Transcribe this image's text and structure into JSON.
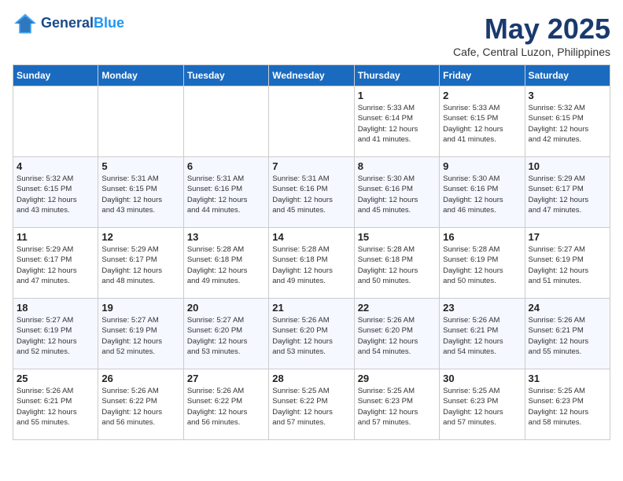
{
  "header": {
    "logo_line1": "General",
    "logo_line2": "Blue",
    "month": "May 2025",
    "location": "Cafe, Central Luzon, Philippines"
  },
  "weekdays": [
    "Sunday",
    "Monday",
    "Tuesday",
    "Wednesday",
    "Thursday",
    "Friday",
    "Saturday"
  ],
  "weeks": [
    [
      {
        "day": "",
        "info": ""
      },
      {
        "day": "",
        "info": ""
      },
      {
        "day": "",
        "info": ""
      },
      {
        "day": "",
        "info": ""
      },
      {
        "day": "1",
        "info": "Sunrise: 5:33 AM\nSunset: 6:14 PM\nDaylight: 12 hours\nand 41 minutes."
      },
      {
        "day": "2",
        "info": "Sunrise: 5:33 AM\nSunset: 6:15 PM\nDaylight: 12 hours\nand 41 minutes."
      },
      {
        "day": "3",
        "info": "Sunrise: 5:32 AM\nSunset: 6:15 PM\nDaylight: 12 hours\nand 42 minutes."
      }
    ],
    [
      {
        "day": "4",
        "info": "Sunrise: 5:32 AM\nSunset: 6:15 PM\nDaylight: 12 hours\nand 43 minutes."
      },
      {
        "day": "5",
        "info": "Sunrise: 5:31 AM\nSunset: 6:15 PM\nDaylight: 12 hours\nand 43 minutes."
      },
      {
        "day": "6",
        "info": "Sunrise: 5:31 AM\nSunset: 6:16 PM\nDaylight: 12 hours\nand 44 minutes."
      },
      {
        "day": "7",
        "info": "Sunrise: 5:31 AM\nSunset: 6:16 PM\nDaylight: 12 hours\nand 45 minutes."
      },
      {
        "day": "8",
        "info": "Sunrise: 5:30 AM\nSunset: 6:16 PM\nDaylight: 12 hours\nand 45 minutes."
      },
      {
        "day": "9",
        "info": "Sunrise: 5:30 AM\nSunset: 6:16 PM\nDaylight: 12 hours\nand 46 minutes."
      },
      {
        "day": "10",
        "info": "Sunrise: 5:29 AM\nSunset: 6:17 PM\nDaylight: 12 hours\nand 47 minutes."
      }
    ],
    [
      {
        "day": "11",
        "info": "Sunrise: 5:29 AM\nSunset: 6:17 PM\nDaylight: 12 hours\nand 47 minutes."
      },
      {
        "day": "12",
        "info": "Sunrise: 5:29 AM\nSunset: 6:17 PM\nDaylight: 12 hours\nand 48 minutes."
      },
      {
        "day": "13",
        "info": "Sunrise: 5:28 AM\nSunset: 6:18 PM\nDaylight: 12 hours\nand 49 minutes."
      },
      {
        "day": "14",
        "info": "Sunrise: 5:28 AM\nSunset: 6:18 PM\nDaylight: 12 hours\nand 49 minutes."
      },
      {
        "day": "15",
        "info": "Sunrise: 5:28 AM\nSunset: 6:18 PM\nDaylight: 12 hours\nand 50 minutes."
      },
      {
        "day": "16",
        "info": "Sunrise: 5:28 AM\nSunset: 6:19 PM\nDaylight: 12 hours\nand 50 minutes."
      },
      {
        "day": "17",
        "info": "Sunrise: 5:27 AM\nSunset: 6:19 PM\nDaylight: 12 hours\nand 51 minutes."
      }
    ],
    [
      {
        "day": "18",
        "info": "Sunrise: 5:27 AM\nSunset: 6:19 PM\nDaylight: 12 hours\nand 52 minutes."
      },
      {
        "day": "19",
        "info": "Sunrise: 5:27 AM\nSunset: 6:19 PM\nDaylight: 12 hours\nand 52 minutes."
      },
      {
        "day": "20",
        "info": "Sunrise: 5:27 AM\nSunset: 6:20 PM\nDaylight: 12 hours\nand 53 minutes."
      },
      {
        "day": "21",
        "info": "Sunrise: 5:26 AM\nSunset: 6:20 PM\nDaylight: 12 hours\nand 53 minutes."
      },
      {
        "day": "22",
        "info": "Sunrise: 5:26 AM\nSunset: 6:20 PM\nDaylight: 12 hours\nand 54 minutes."
      },
      {
        "day": "23",
        "info": "Sunrise: 5:26 AM\nSunset: 6:21 PM\nDaylight: 12 hours\nand 54 minutes."
      },
      {
        "day": "24",
        "info": "Sunrise: 5:26 AM\nSunset: 6:21 PM\nDaylight: 12 hours\nand 55 minutes."
      }
    ],
    [
      {
        "day": "25",
        "info": "Sunrise: 5:26 AM\nSunset: 6:21 PM\nDaylight: 12 hours\nand 55 minutes."
      },
      {
        "day": "26",
        "info": "Sunrise: 5:26 AM\nSunset: 6:22 PM\nDaylight: 12 hours\nand 56 minutes."
      },
      {
        "day": "27",
        "info": "Sunrise: 5:26 AM\nSunset: 6:22 PM\nDaylight: 12 hours\nand 56 minutes."
      },
      {
        "day": "28",
        "info": "Sunrise: 5:25 AM\nSunset: 6:22 PM\nDaylight: 12 hours\nand 57 minutes."
      },
      {
        "day": "29",
        "info": "Sunrise: 5:25 AM\nSunset: 6:23 PM\nDaylight: 12 hours\nand 57 minutes."
      },
      {
        "day": "30",
        "info": "Sunrise: 5:25 AM\nSunset: 6:23 PM\nDaylight: 12 hours\nand 57 minutes."
      },
      {
        "day": "31",
        "info": "Sunrise: 5:25 AM\nSunset: 6:23 PM\nDaylight: 12 hours\nand 58 minutes."
      }
    ]
  ]
}
